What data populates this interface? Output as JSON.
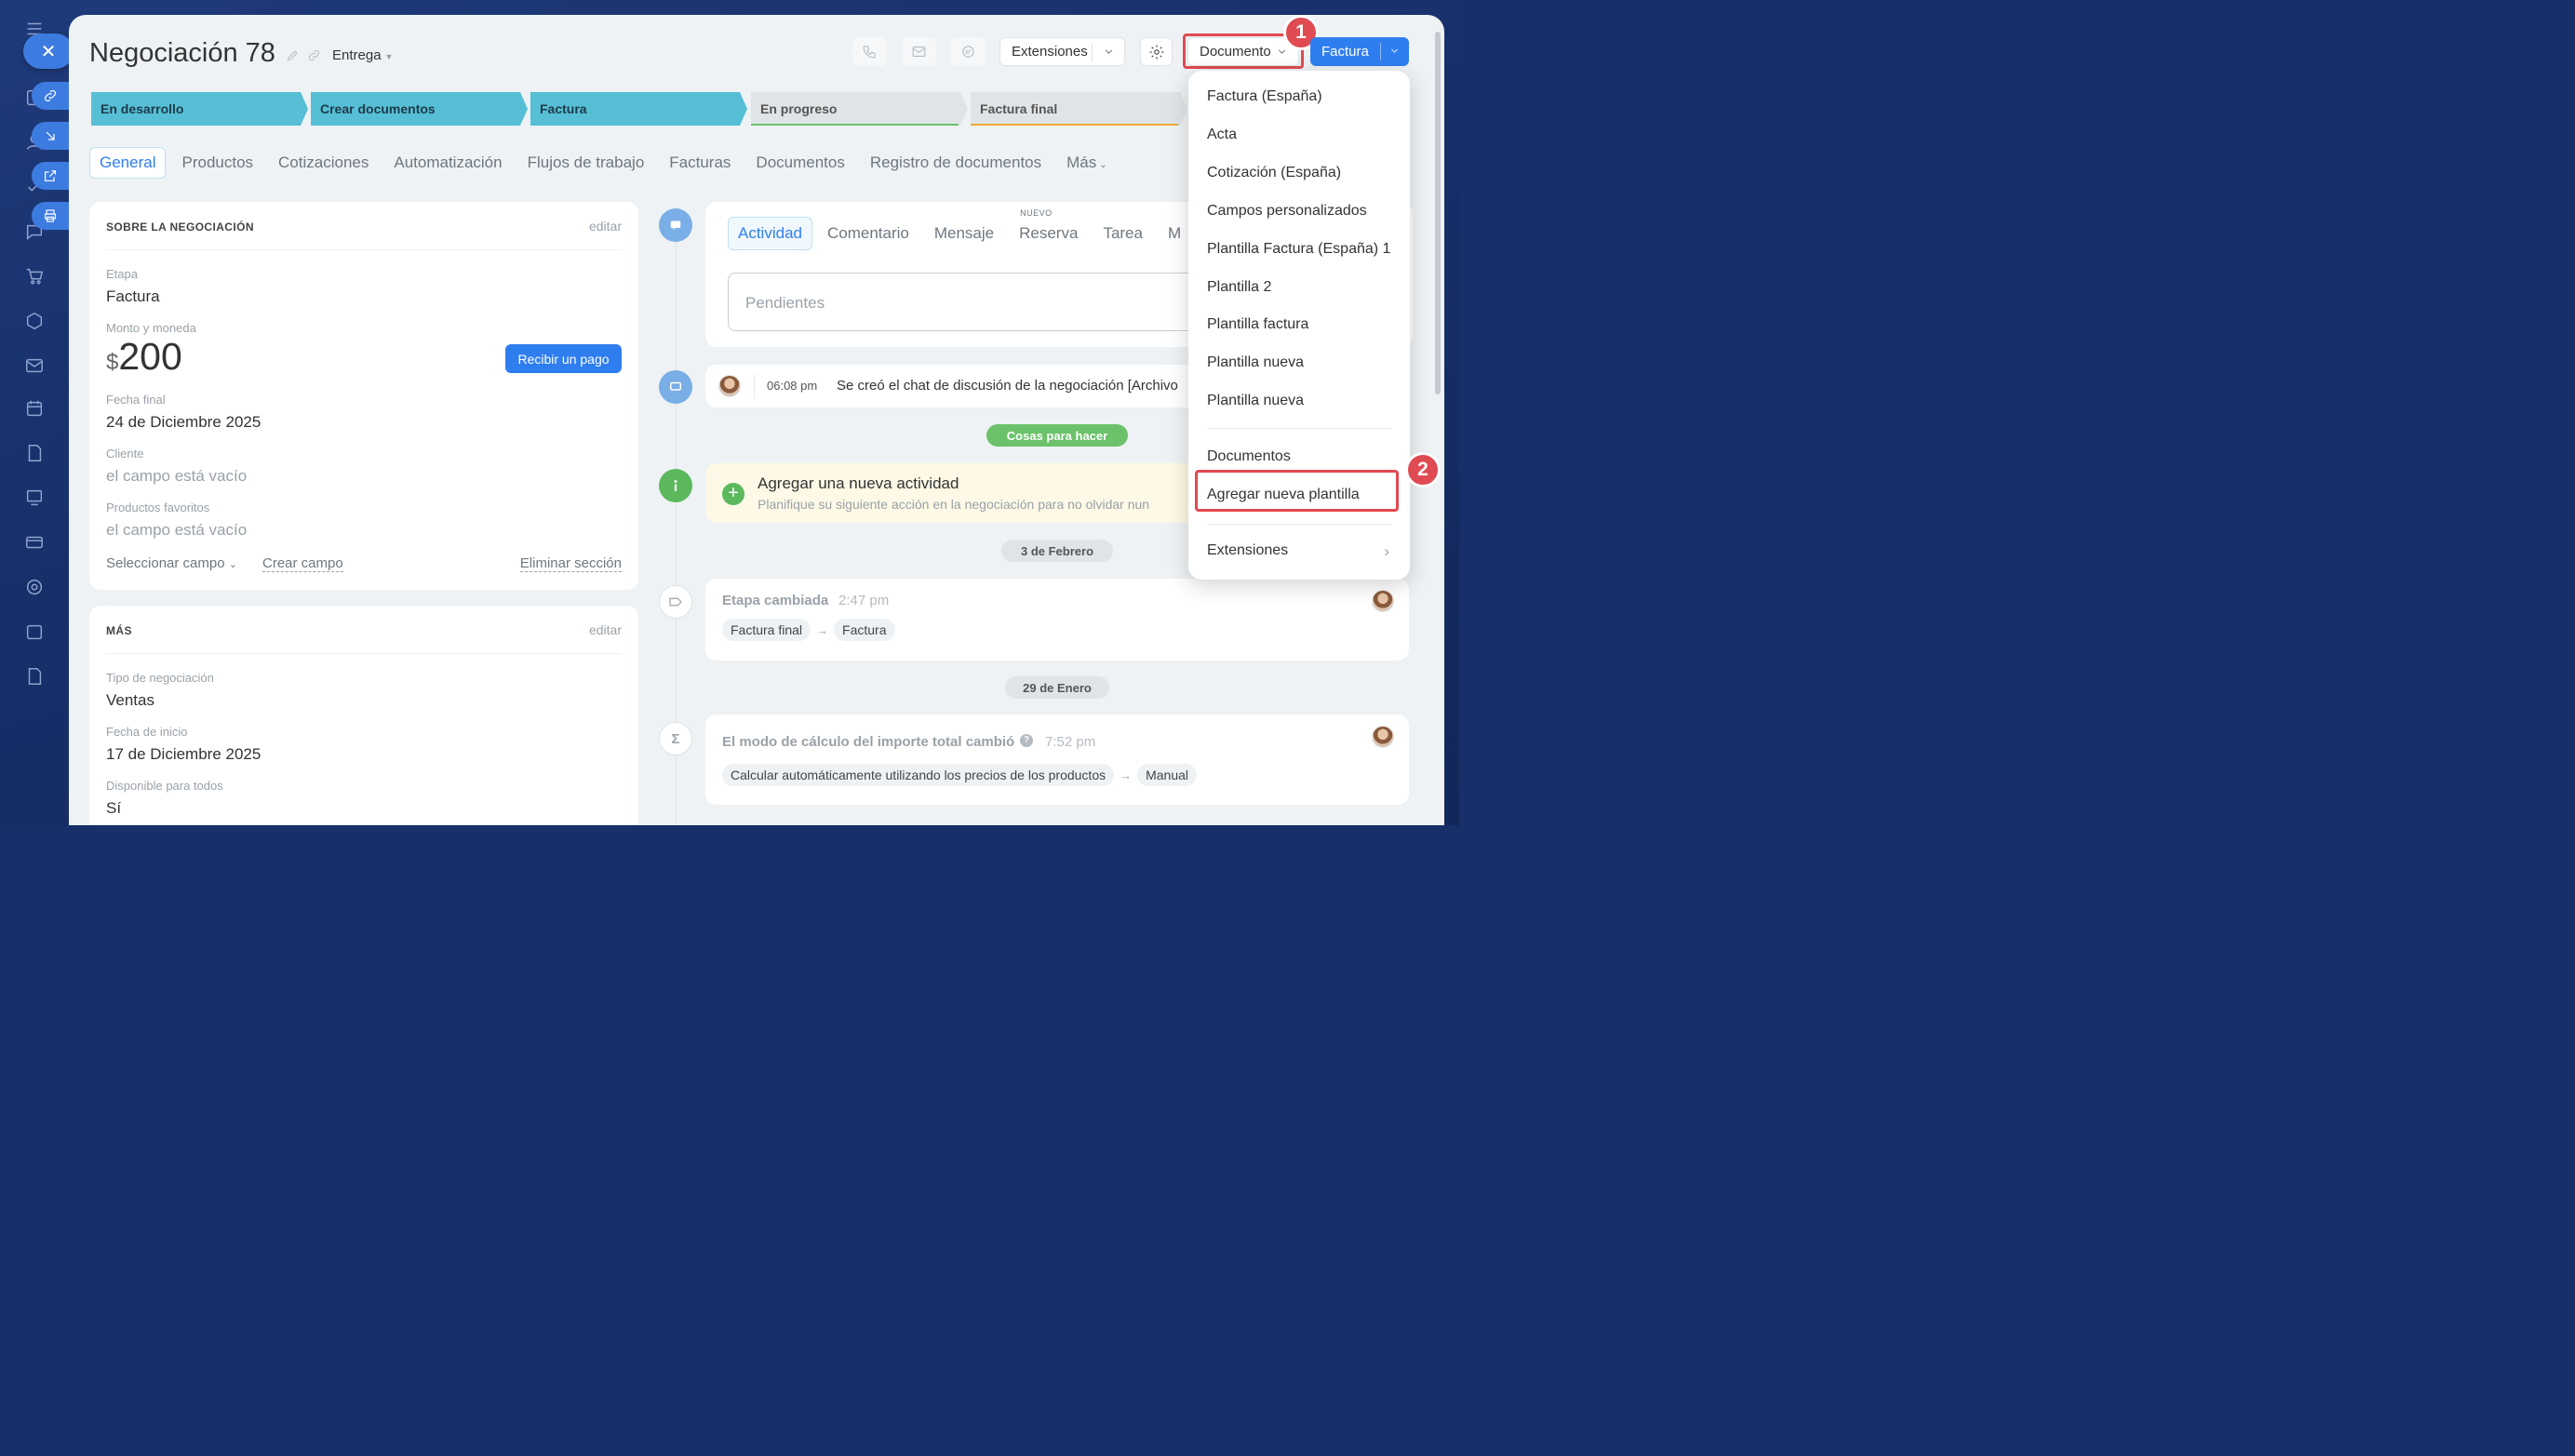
{
  "deal": {
    "title": "Negociación 78",
    "pipeline": "Entrega"
  },
  "header": {
    "extensions_label": "Extensiones",
    "document_label": "Documento",
    "invoice_label": "Factura"
  },
  "annotations": {
    "badge1": "1",
    "badge2": "2"
  },
  "stages": [
    {
      "label": "En desarrollo",
      "state": "done"
    },
    {
      "label": "Crear documentos",
      "state": "done"
    },
    {
      "label": "Factura",
      "state": "current"
    },
    {
      "label": "En progreso",
      "state": "todo",
      "color": "#6bc26b"
    },
    {
      "label": "Factura final",
      "state": "todo",
      "color": "#f2a93b"
    }
  ],
  "tabs": [
    "General",
    "Productos",
    "Cotizaciones",
    "Automatización",
    "Flujos de trabajo",
    "Facturas",
    "Documentos",
    "Registro de documentos",
    "Más"
  ],
  "about": {
    "heading": "SOBRE LA NEGOCIACIÓN",
    "edit": "editar",
    "stage_label": "Etapa",
    "stage_value": "Factura",
    "amount_label": "Monto y moneda",
    "currency": "$",
    "amount": "200",
    "pay_button": "Recibir un pago",
    "end_date_label": "Fecha final",
    "end_date_value": "24 de Diciembre 2025",
    "client_label": "Cliente",
    "client_value": "el campo está vacío",
    "fav_products_label": "Productos favoritos",
    "fav_products_value": "el campo está vacío",
    "select_field": "Seleccionar campo",
    "create_field": "Crear campo",
    "delete_section": "Eliminar sección"
  },
  "more": {
    "heading": "MÁS",
    "edit": "editar",
    "type_label": "Tipo de negociación",
    "type_value": "Ventas",
    "start_label": "Fecha de inicio",
    "start_value": "17 de Diciembre 2025",
    "available_label": "Disponible para todos",
    "available_value": "Sí"
  },
  "activity": {
    "tabs": [
      "Actividad",
      "Comentario",
      "Mensaje",
      "Reserva",
      "Tarea",
      "M"
    ],
    "new_tag": "NUEVO",
    "pending_placeholder": "Pendientes"
  },
  "timeline": {
    "chat_time": "06:08 pm",
    "chat_text": "Se creó el chat de discusión de la negociación [Archivo",
    "todo_pill": "Cosas para hacer",
    "add_activity_title": "Agregar una nueva actividad",
    "add_activity_sub": "Planifique su siguiente acción en la negociación para no olvidar nun",
    "date1": "3 de Febrero",
    "stage_changed": "Etapa cambiada",
    "stage_changed_time": "2:47 pm",
    "stage_from": "Factura final",
    "stage_to": "Factura",
    "date2": "29 de Enero",
    "calc_changed": "El modo de cálculo del importe total cambió",
    "calc_time": "7:52 pm",
    "calc_from": "Calcular automáticamente utilizando los precios de los productos",
    "calc_to": "Manual"
  },
  "menu": {
    "items": [
      "Factura (España)",
      "Acta",
      "Cotización (España)",
      "Campos personalizados",
      "Plantilla Factura (España) 1",
      "Plantilla 2",
      "Plantilla factura",
      "Plantilla nueva",
      "Plantilla nueva"
    ],
    "documents": "Documentos",
    "add_template": "Agregar nueva plantilla",
    "extensions": "Extensiones"
  },
  "colors": {
    "accent": "#2f7ef0",
    "stage_active": "#56bfd6",
    "highlight": "#e04a52",
    "todo_pill": "#6bc26b"
  }
}
